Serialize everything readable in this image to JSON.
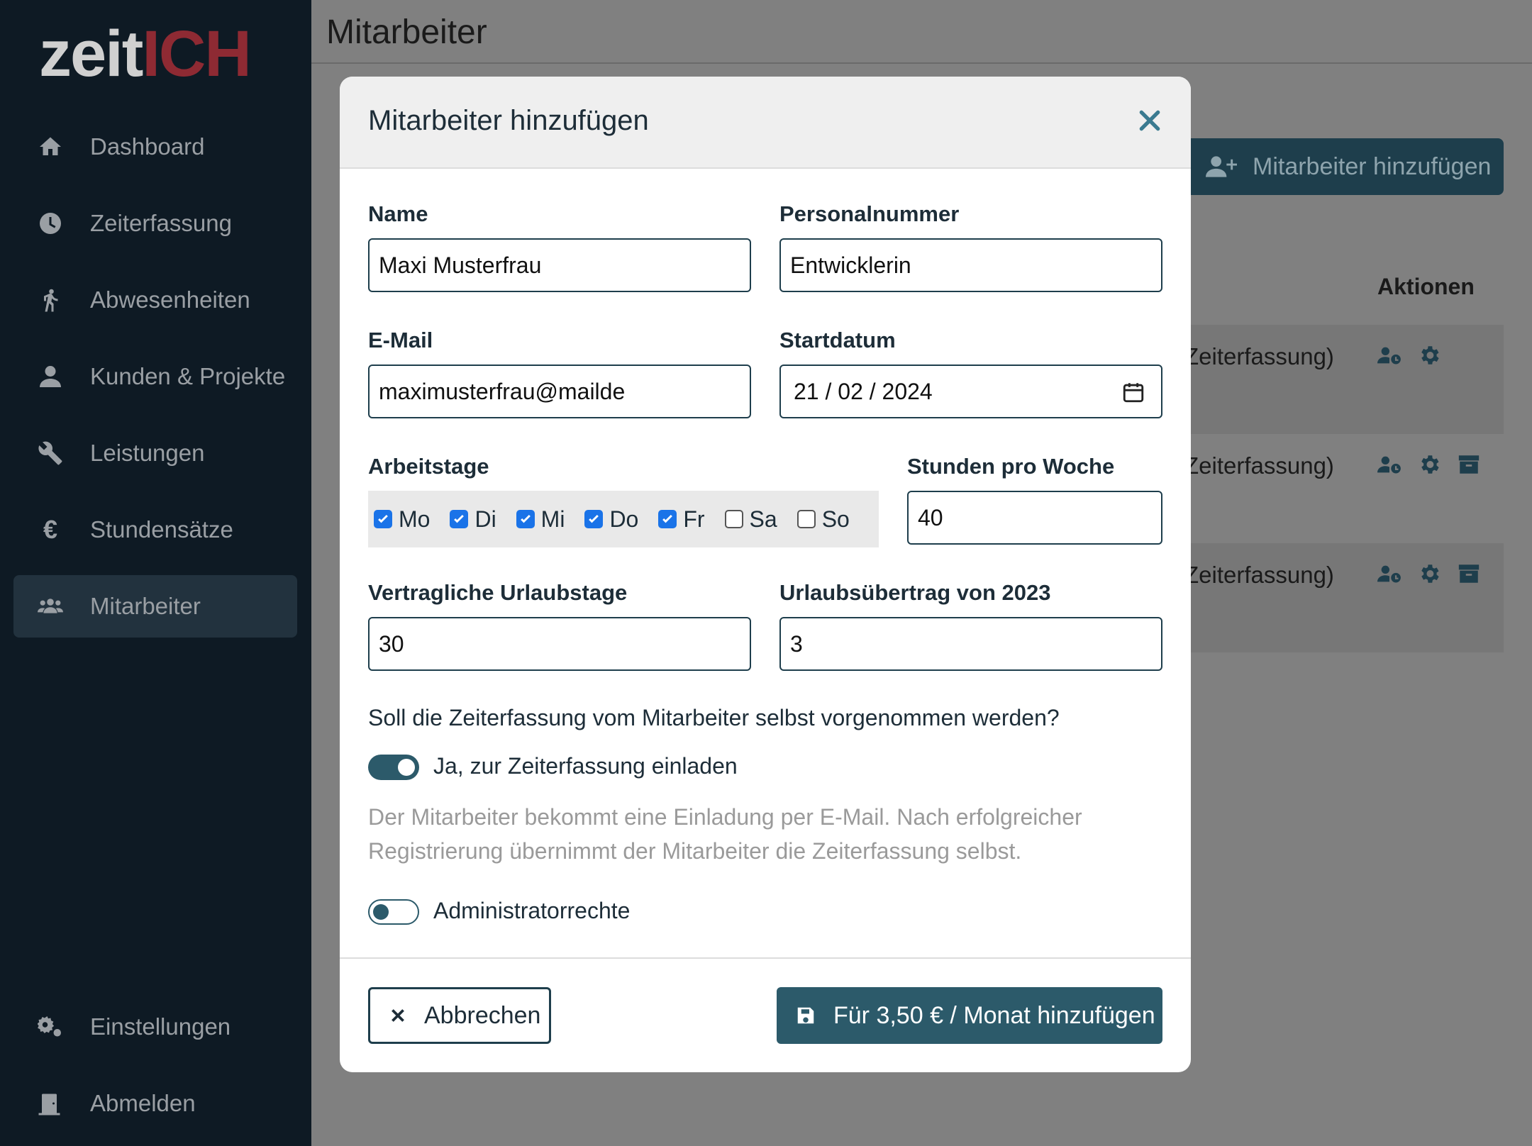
{
  "logo": {
    "part1": "zeit",
    "part2": "ICH"
  },
  "sidebar": {
    "items": [
      {
        "label": "Dashboard",
        "icon": "home-icon"
      },
      {
        "label": "Zeiterfassung",
        "icon": "clock-icon"
      },
      {
        "label": "Abwesenheiten",
        "icon": "walking-icon"
      },
      {
        "label": "Kunden & Projekte",
        "icon": "user-icon"
      },
      {
        "label": "Leistungen",
        "icon": "wrench-icon"
      },
      {
        "label": "Stundensätze",
        "icon": "euro-icon"
      },
      {
        "label": "Mitarbeiter",
        "icon": "users-icon",
        "active": true
      }
    ],
    "bottom": [
      {
        "label": "Einstellungen",
        "icon": "gears-icon"
      },
      {
        "label": "Abmelden",
        "icon": "door-icon"
      }
    ]
  },
  "page": {
    "title": "Mitarbeiter",
    "add_button": "Mitarbeiter hinzufügen",
    "actions_header": "Aktionen",
    "rows": [
      {
        "text": "Zeiterfassung)"
      },
      {
        "text": "Zeiterfassung)"
      },
      {
        "text": "Zeiterfassung)"
      }
    ]
  },
  "modal": {
    "title": "Mitarbeiter hinzufügen",
    "name_label": "Name",
    "name_value": "Maxi Musterfrau",
    "personalnummer_label": "Personalnummer",
    "personalnummer_value": "Entwicklerin",
    "email_label": "E-Mail",
    "email_value": "maximusterfrau@mailde",
    "startdatum_label": "Startdatum",
    "startdatum_value": "21 / 02 / 2024",
    "arbeitstage_label": "Arbeitstage",
    "days": [
      {
        "label": "Mo",
        "checked": true
      },
      {
        "label": "Di",
        "checked": true
      },
      {
        "label": "Mi",
        "checked": true
      },
      {
        "label": "Do",
        "checked": true
      },
      {
        "label": "Fr",
        "checked": true
      },
      {
        "label": "Sa",
        "checked": false
      },
      {
        "label": "So",
        "checked": false
      }
    ],
    "stunden_label": "Stunden pro Woche",
    "stunden_value": "40",
    "urlaub_label": "Vertragliche Urlaubstage",
    "urlaub_value": "30",
    "uebertrag_label": "Urlaubsübertrag von 2023",
    "uebertrag_value": "3",
    "question": "Soll die Zeiterfassung vom Mitarbeiter selbst vorgenommen werden?",
    "invite_toggle": {
      "label": "Ja, zur Zeiterfassung einladen",
      "on": true
    },
    "help_line1": "Der Mitarbeiter bekommt eine Einladung per E-Mail. Nach erfolgreicher",
    "help_line2": "Registrierung übernimmt der Mitarbeiter die Zeiterfassung selbst.",
    "admin_toggle": {
      "label": "Administratorrechte",
      "on": false
    },
    "cancel_label": "Abbrechen",
    "save_label": "Für 3,50 € / Monat hinzufügen"
  },
  "colors": {
    "accent": "#2c5a6a",
    "sidebar": "#0e1a24",
    "logo_red": "#8e2a33",
    "checkbox": "#1a73e8"
  }
}
